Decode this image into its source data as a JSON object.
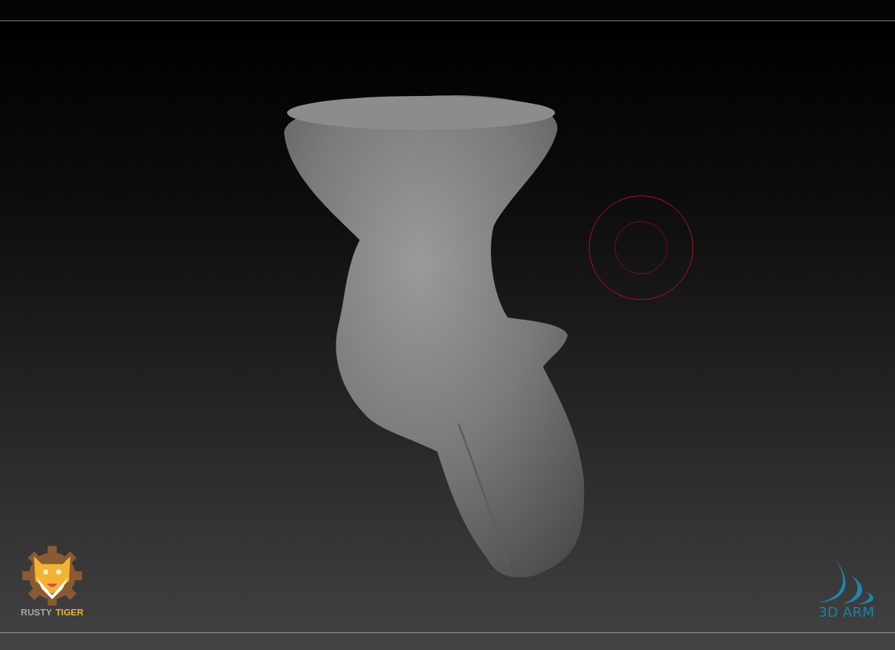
{
  "logo_left": {
    "first_word": "RUSTY",
    "second_word": "TIGER"
  },
  "logo_right": {
    "text": "3D ARM"
  }
}
